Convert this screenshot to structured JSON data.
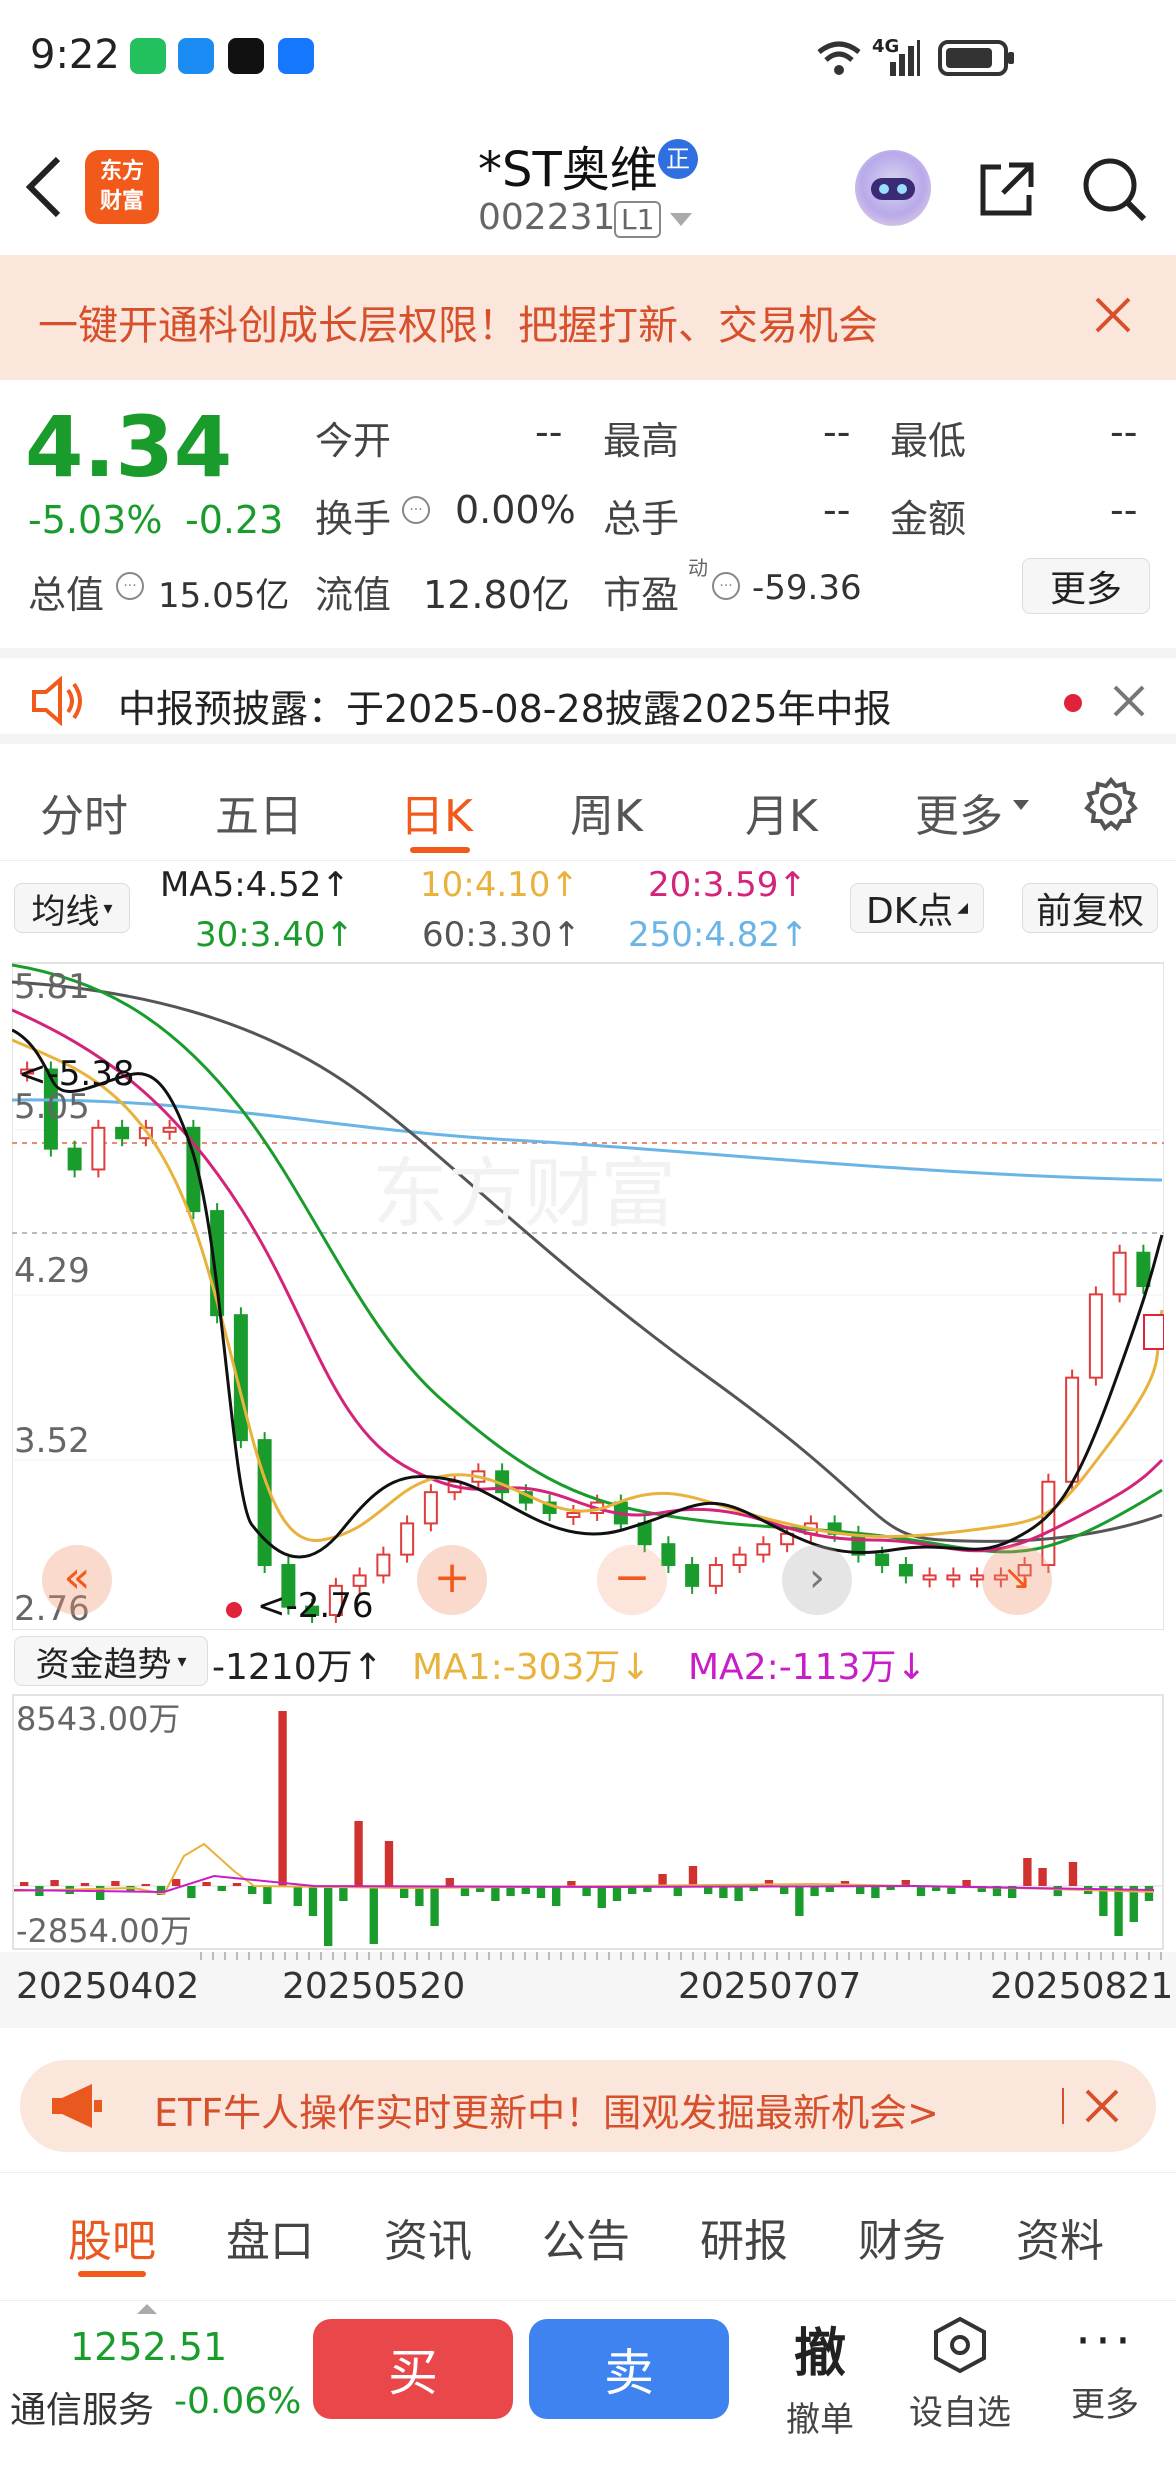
{
  "status": {
    "time": "9:22",
    "apps": [
      "wechat-icon",
      "message-icon",
      "tiktok-icon",
      "alipay-icon"
    ],
    "net": "4G"
  },
  "header": {
    "logo_line1": "东方",
    "logo_line2": "财富",
    "title": "*ST奥维",
    "badge": "正",
    "code": "002231",
    "level": "L1"
  },
  "banner": {
    "text": "一键开通科创成长层权限！把握打新、交易机会"
  },
  "quote": {
    "price": "4.34",
    "change_pct": "-5.03%",
    "change": "-0.23",
    "open_label": "今开",
    "open": "--",
    "high_label": "最高",
    "high": "--",
    "low_label": "最低",
    "low": "--",
    "turnover_label": "换手",
    "turnover": "0.00%",
    "volume_label": "总手",
    "volume": "--",
    "amount_label": "金额",
    "amount": "--",
    "mktcap_label": "总值",
    "mktcap": "15.05亿",
    "float_label": "流值",
    "float": "12.80亿",
    "pe_label": "市盈",
    "pe_sup": "动",
    "pe": "-59.36",
    "more_label": "更多"
  },
  "notice": {
    "text": "中报预披露：于2025-08-28披露2025年中报"
  },
  "tabs": [
    "分时",
    "五日",
    "日K",
    "周K",
    "月K",
    "更多"
  ],
  "active_tab": "日K",
  "ma": {
    "selector": "均线",
    "ma5": "MA5:4.52↑",
    "ma10": "10:4.10↑",
    "ma20": "20:3.59↑",
    "ma30": "30:3.40↑",
    "ma60": "60:3.30↑",
    "ma250": "250:4.82↑",
    "dk": "DK点",
    "adjust": "前复权"
  },
  "colors": {
    "ma5": "#111111",
    "ma10": "#e8b23c",
    "ma20": "#d4237a",
    "ma30": "#1a9c2c",
    "ma60": "#555555",
    "ma250": "#6ab4e6",
    "up": "#e03c3c",
    "down": "#1a9c2c",
    "accent": "#f25a1c"
  },
  "chart": {
    "price_labels": [
      "5.81",
      "5.05",
      "4.29",
      "3.52",
      "2.76"
    ],
    "high_mark": "<-5.38",
    "low_mark": "<-2.76",
    "watermark": "东方财富",
    "fund_selector": "资金趋势",
    "fund_val": "-1210万↑",
    "fund_ma1": "MA1:-303万↓",
    "fund_ma2": "MA2:-113万↓",
    "fund_max": "8543.00万",
    "fund_min": "-2854.00万",
    "dates": [
      "20250402",
      "20250520",
      "20250707",
      "20250821"
    ]
  },
  "chart_data": {
    "type": "candlestick",
    "y_range": [
      2.76,
      5.81
    ],
    "closes": [
      5.38,
      5.0,
      4.9,
      5.1,
      5.05,
      5.1,
      5.1,
      4.7,
      4.2,
      3.6,
      3.0,
      2.8,
      2.76,
      2.9,
      2.95,
      3.05,
      3.2,
      3.35,
      3.4,
      3.45,
      3.35,
      3.3,
      3.25,
      3.25,
      3.3,
      3.2,
      3.1,
      3.0,
      2.9,
      3.0,
      3.05,
      3.1,
      3.15,
      3.2,
      3.15,
      3.05,
      3.0,
      2.95,
      2.95,
      2.95,
      2.95,
      2.95,
      3.0,
      3.4,
      3.9,
      4.3,
      4.5,
      4.34
    ]
  },
  "etf": {
    "text": "ETF牛人操作实时更新中！围观发掘最新机会>"
  },
  "bottom_tabs": [
    "股吧",
    "盘口",
    "资讯",
    "公告",
    "研报",
    "财务",
    "资料"
  ],
  "index": {
    "value": "1252.51",
    "name": "通信服务",
    "pct": "-0.06%"
  },
  "actions": {
    "buy": "买",
    "sell": "卖",
    "cancel_icon": "撤",
    "cancel": "撤单",
    "watch": "设自选",
    "more": "更多"
  }
}
